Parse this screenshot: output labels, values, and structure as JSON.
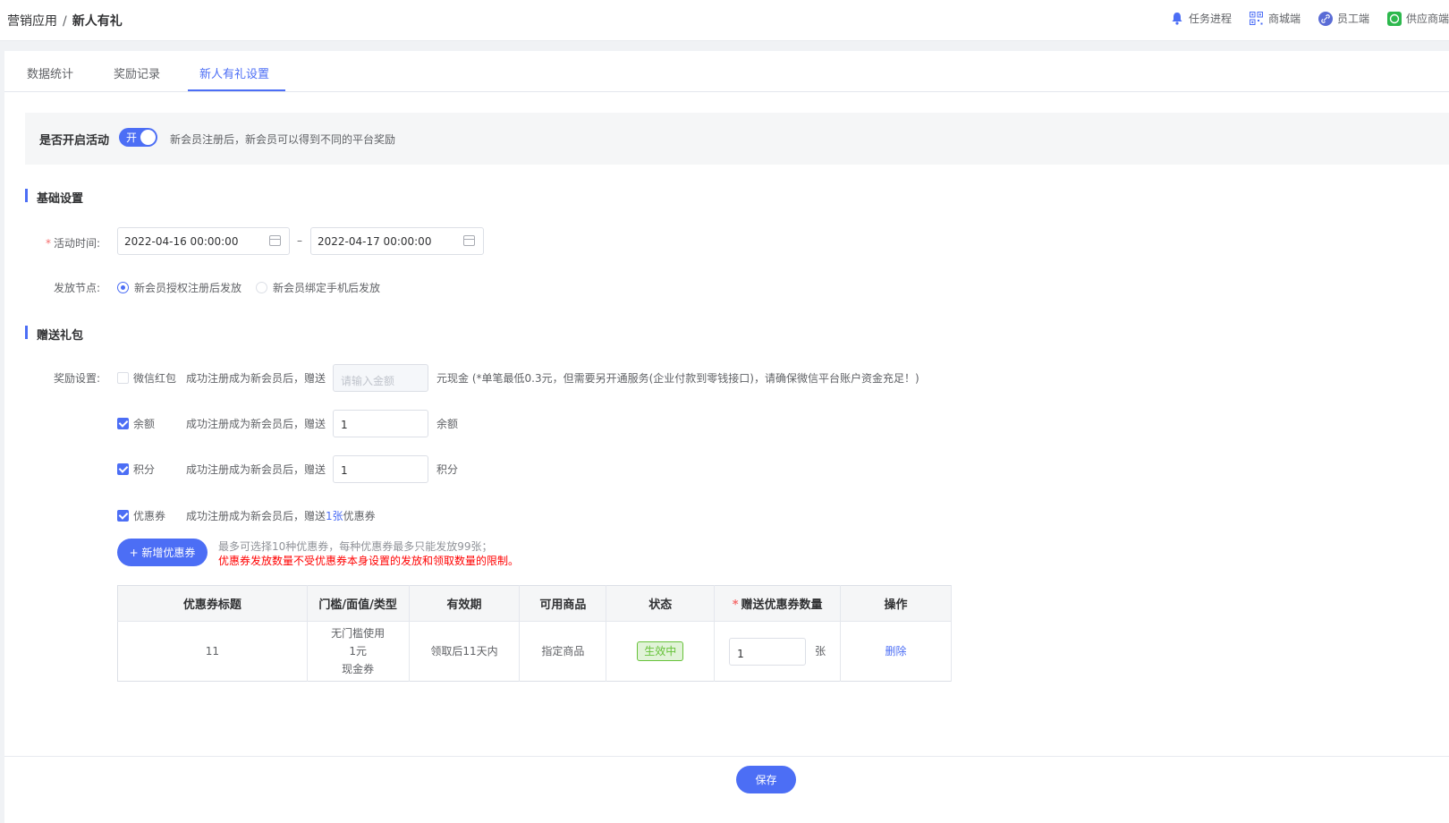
{
  "breadcrumb": {
    "parent": "营销应用",
    "separator": "/",
    "current": "新人有礼"
  },
  "toplinks": [
    {
      "label": "任务进程",
      "icon": "bell-icon"
    },
    {
      "label": "商城端",
      "icon": "qrcode-icon"
    },
    {
      "label": "员工端",
      "icon": "link-icon"
    },
    {
      "label": "供应商端",
      "icon": "supplier-icon"
    }
  ],
  "tabs": [
    "数据统计",
    "奖励记录",
    "新人有礼设置"
  ],
  "active_tab": "新人有礼设置",
  "activity_switch": {
    "label": "是否开启活动",
    "state_text": "开",
    "on": true,
    "description": "新会员注册后，新会员可以得到不同的平台奖励"
  },
  "basic": {
    "title": "基础设置",
    "time_label": "活动时间:",
    "start": "2022-04-16 00:00:00",
    "range_sep": "–",
    "end": "2022-04-17 00:00:00",
    "node_label": "发放节点:",
    "node_options": [
      "新会员授权注册后发放",
      "新会员绑定手机后发放"
    ],
    "node_selected": 0
  },
  "gift": {
    "title": "赠送礼包",
    "reward_label": "奖励设置:",
    "rows": [
      {
        "name": "微信红包",
        "checked": false,
        "text": "成功注册成为新会员后，赠送",
        "value": "",
        "placeholder": "请输入金额",
        "unit": "元现金 (*单笔最低0.3元，但需要另开通服务(企业付款到零钱接口)，请确保微信平台账户资金充足！)"
      },
      {
        "name": "余额",
        "checked": true,
        "text": "成功注册成为新会员后，赠送",
        "value": "1",
        "placeholder": "",
        "unit": "余额"
      },
      {
        "name": "积分",
        "checked": true,
        "text": "成功注册成为新会员后，赠送",
        "value": "1",
        "placeholder": "",
        "unit": "积分"
      }
    ],
    "coupon": {
      "name": "优惠券",
      "checked": true,
      "prefix": "成功注册成为新会员后，赠送",
      "link": "1张",
      "suffix": "优惠券"
    },
    "add_button": "+ 新增优惠券",
    "tip_line1": "最多可选择10种优惠券，每种优惠券最多只能发放99张；",
    "tip_line2": "优惠券发放数量不受优惠券本身设置的发放和领取数量的限制。"
  },
  "table": {
    "headers": [
      "优惠券标题",
      "门槛/面值/类型",
      "有效期",
      "可用商品",
      "状态",
      "赠送优惠券数量",
      "操作"
    ],
    "rows": [
      {
        "title": "11",
        "threshold": "无门槛使用",
        "face": "1元",
        "type": "现金券",
        "validity": "领取后11天内",
        "goods": "指定商品",
        "status": "生效中",
        "qty": "1",
        "qty_unit": "张",
        "op": "删除"
      }
    ]
  },
  "save_button": "保存",
  "colors": {
    "primary": "#4c6ef5",
    "success": "#67c23a",
    "danger": "#f00"
  }
}
